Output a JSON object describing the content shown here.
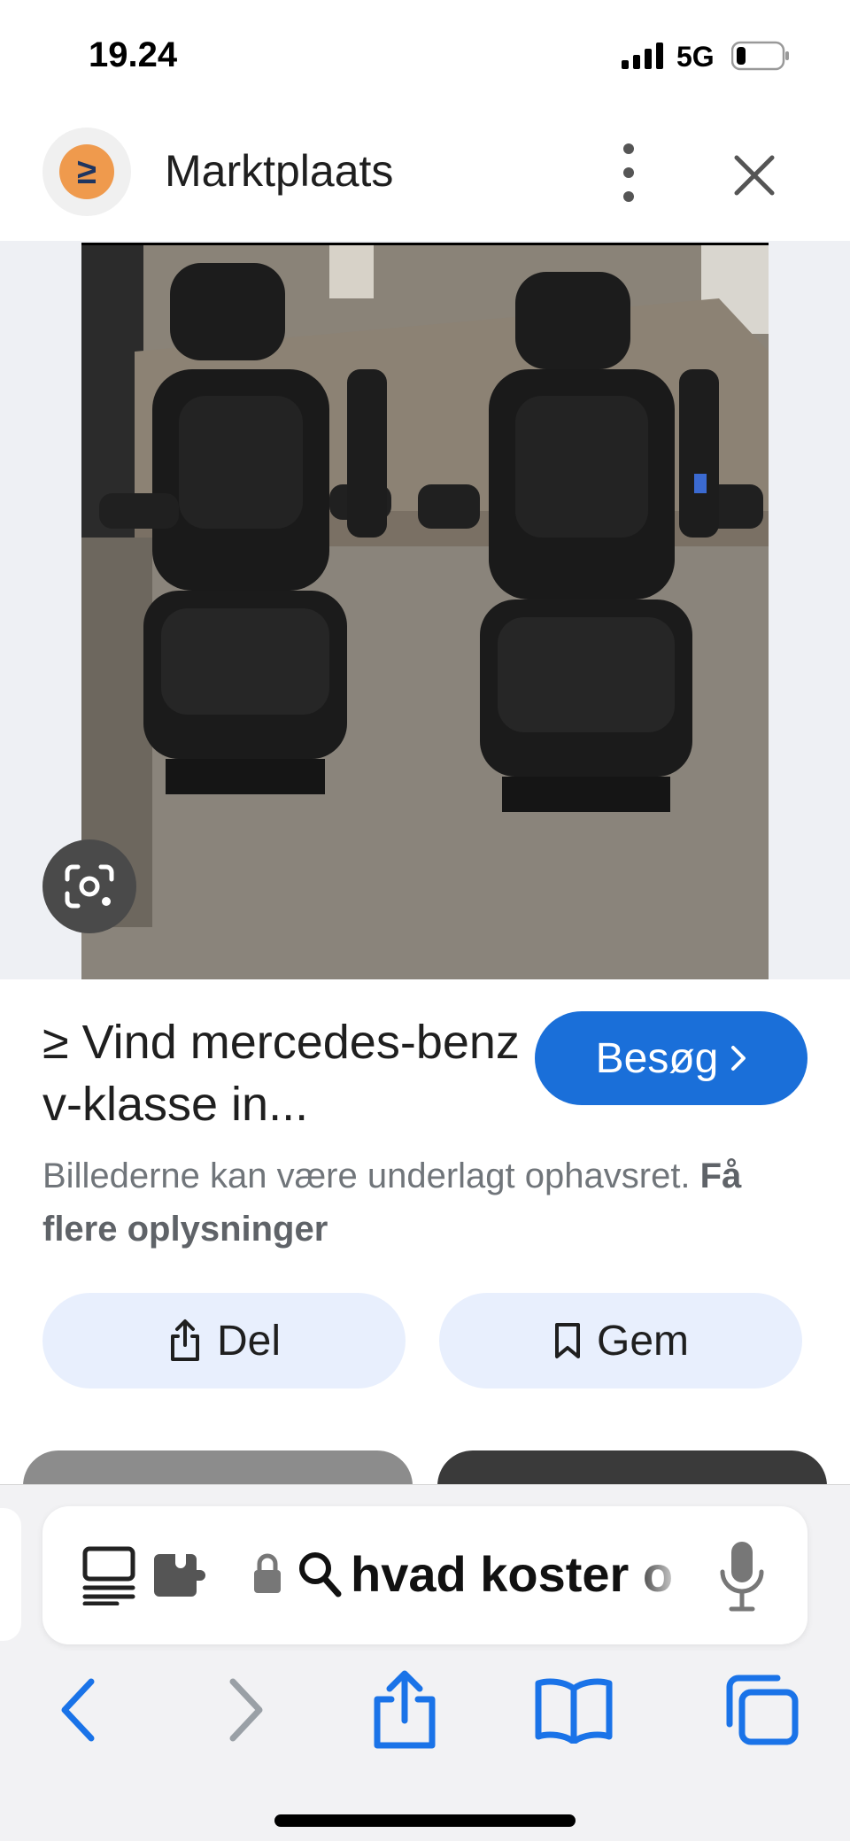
{
  "status_bar": {
    "time": "19.24",
    "network": "5G",
    "battery_level": 0.2
  },
  "header": {
    "site_name": "Marktplaats",
    "logo_glyph": "≥",
    "logo_color": "#ef9a4d"
  },
  "image": {
    "lens_icon": "google-lens-icon"
  },
  "result": {
    "title": "≥ Vind mercedes-benz v-klasse in...",
    "visit_label": "Besøg",
    "copyright_text": "Billederne kan være underlagt ophavsret.",
    "copyright_link": "Få flere oplysninger"
  },
  "actions": {
    "share_label": "Del",
    "save_label": "Gem"
  },
  "browser": {
    "address_text": "hvad koster o",
    "accent_color": "#1a6fd9"
  },
  "colors": {
    "visit_button": "#1a6fd9",
    "pill_background": "#e8effd",
    "toolbar_icon": "#1a73e8"
  }
}
